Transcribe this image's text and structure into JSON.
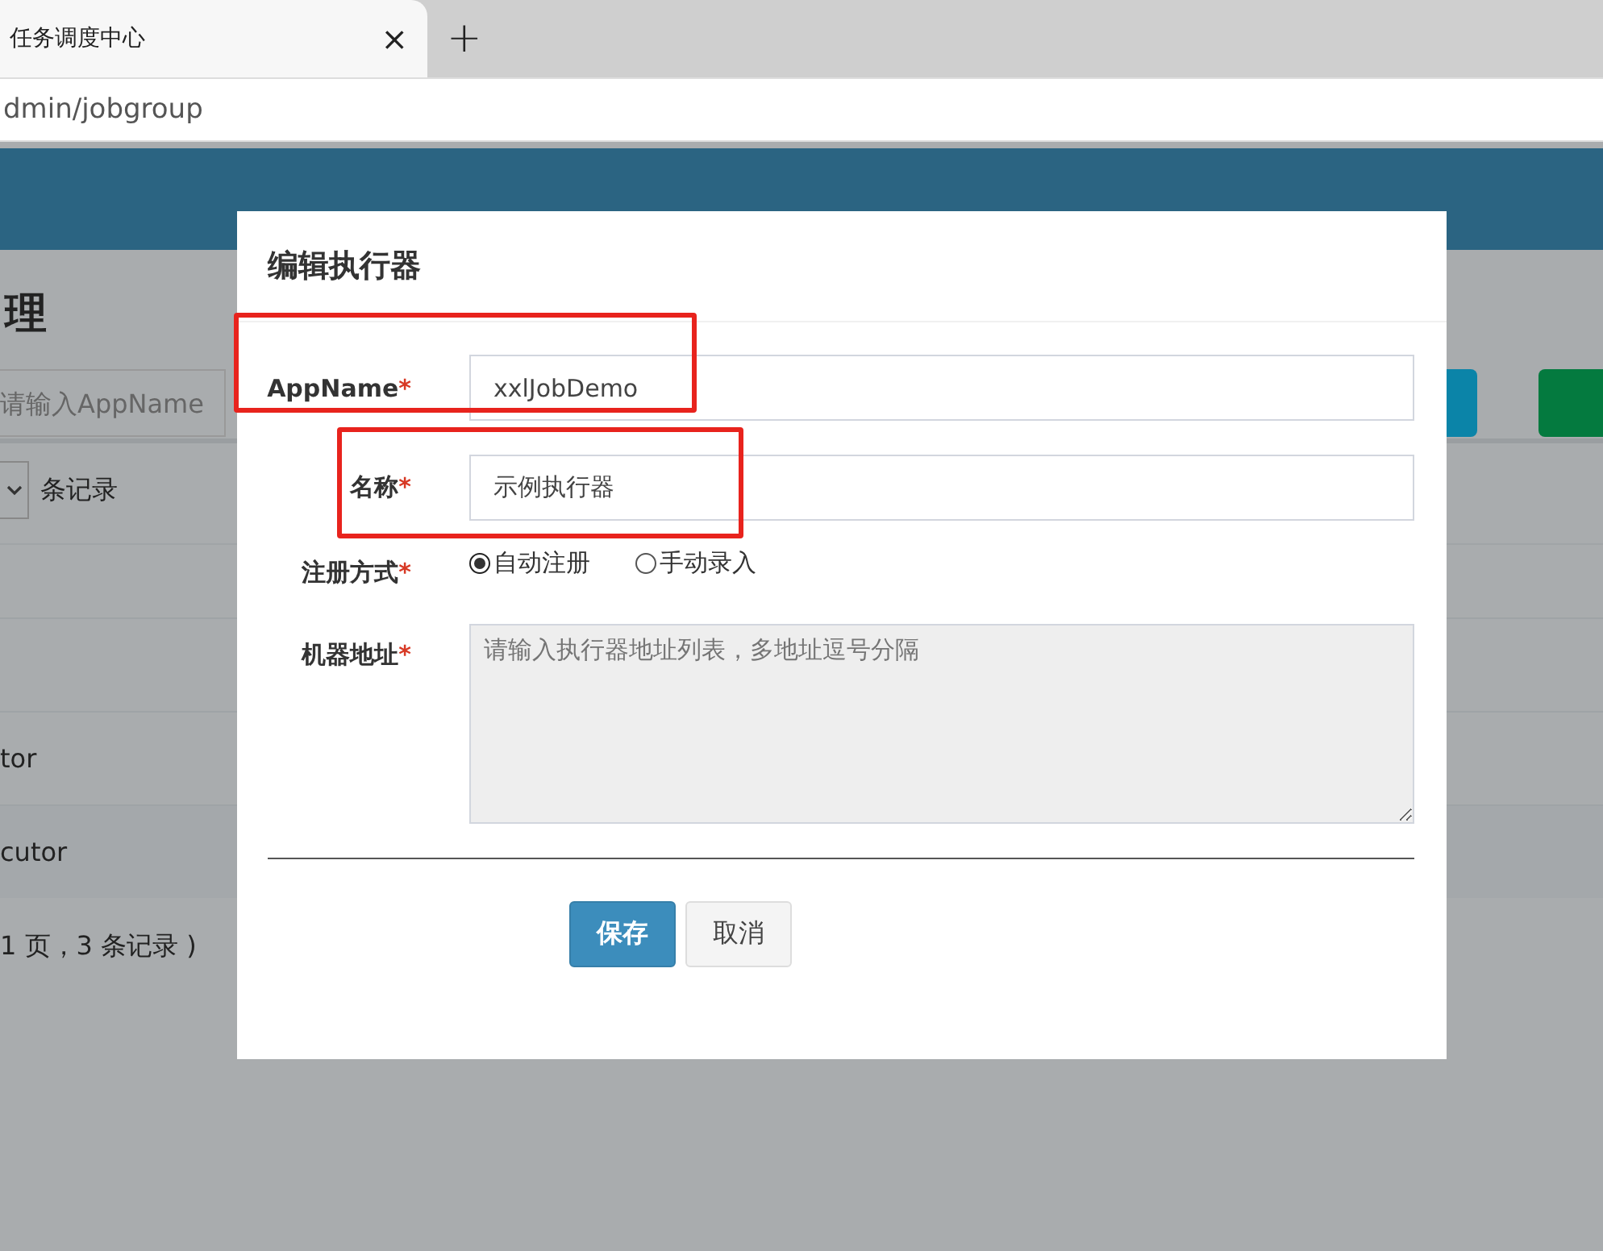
{
  "browser": {
    "tab_title": "任务调度中心",
    "close": "×",
    "new_tab": "+",
    "address": "dmin/jobgroup"
  },
  "page": {
    "title": "理",
    "search": {
      "placeholder": "请输入AppName"
    },
    "page_size_label": "条记录",
    "rows": [
      {
        "cell": "tor"
      },
      {
        "cell": "cutor"
      }
    ],
    "footer": "1 页，3 条记录 )"
  },
  "dialog": {
    "title": "编辑执行器",
    "fields": [
      {
        "kind": "input",
        "label": "AppName",
        "required_mark": "*",
        "value": "xxlJobDemo",
        "highlighted": true
      },
      {
        "kind": "input",
        "label": "名称",
        "required_mark": "*",
        "value": "示例执行器",
        "highlighted": true
      },
      {
        "kind": "radio",
        "label": "注册方式",
        "required_mark": "*",
        "options": [
          {
            "label": "自动注册",
            "selected": true
          },
          {
            "label": "手动录入",
            "selected": false
          }
        ]
      },
      {
        "kind": "textarea",
        "label": "机器地址",
        "required_mark": "*",
        "placeholder": "请输入执行器地址列表，多地址逗号分隔",
        "disabled": true
      }
    ],
    "buttons": [
      {
        "label": "保存",
        "kind": "primary"
      },
      {
        "label": "取消",
        "kind": "default"
      }
    ]
  }
}
